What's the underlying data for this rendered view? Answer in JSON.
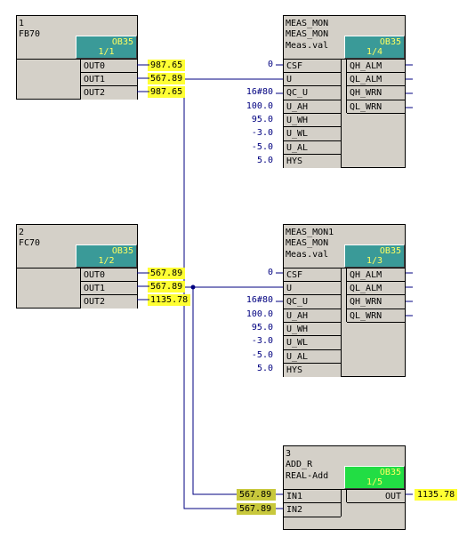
{
  "blocks": {
    "fb70": {
      "num": "1",
      "name": "FB70",
      "ob": "OB35",
      "seq": "1/1",
      "outputs": [
        {
          "pin": "OUT0",
          "val": "987.65"
        },
        {
          "pin": "OUT1",
          "val": "567.89"
        },
        {
          "pin": "OUT2",
          "val": "987.65"
        }
      ]
    },
    "fc70": {
      "num": "2",
      "name": "FC70",
      "ob": "OB35",
      "seq": "1/2",
      "outputs": [
        {
          "pin": "OUT0",
          "val": "567.89"
        },
        {
          "pin": "OUT1",
          "val": "567.89"
        },
        {
          "pin": "OUT2",
          "val": "1135.78"
        }
      ]
    },
    "meas1": {
      "line1": "MEAS_MON",
      "line2": "MEAS_MON",
      "line3": "Meas.val",
      "ob": "OB35",
      "seq": "1/4",
      "inputs": [
        {
          "pin": "CSF",
          "val": "0"
        },
        {
          "pin": "U",
          "val": ""
        },
        {
          "pin": "QC_U",
          "val": "16#80"
        },
        {
          "pin": "U_AH",
          "val": "100.0"
        },
        {
          "pin": "U_WH",
          "val": "95.0"
        },
        {
          "pin": "U_WL",
          "val": "-3.0"
        },
        {
          "pin": "U_AL",
          "val": "-5.0"
        },
        {
          "pin": "HYS",
          "val": "5.0"
        }
      ],
      "outputs": [
        "QH_ALM",
        "QL_ALM",
        "QH_WRN",
        "QL_WRN"
      ]
    },
    "meas2": {
      "line1": "MEAS_MON1",
      "line2": "MEAS_MON",
      "line3": "Meas.val",
      "ob": "OB35",
      "seq": "1/3",
      "inputs": [
        {
          "pin": "CSF",
          "val": "0"
        },
        {
          "pin": "U",
          "val": ""
        },
        {
          "pin": "QC_U",
          "val": "16#80"
        },
        {
          "pin": "U_AH",
          "val": "100.0"
        },
        {
          "pin": "U_WH",
          "val": "95.0"
        },
        {
          "pin": "U_WL",
          "val": "-3.0"
        },
        {
          "pin": "U_AL",
          "val": "-5.0"
        },
        {
          "pin": "HYS",
          "val": "5.0"
        }
      ],
      "outputs": [
        "QH_ALM",
        "QL_ALM",
        "QH_WRN",
        "QL_WRN"
      ]
    },
    "add": {
      "num": "3",
      "line2": "ADD_R",
      "line3": "REAL-Add",
      "ob": "OB35",
      "seq": "1/5",
      "inputs": [
        {
          "pin": "IN1",
          "val": "567.89"
        },
        {
          "pin": "IN2",
          "val": "567.89"
        }
      ],
      "output": {
        "pin": "OUT",
        "val": "1135.78"
      }
    }
  },
  "colors": {
    "tag_teal": "#3a9a98",
    "tag_green": "#22dd44",
    "value_yellow": "#ffff33",
    "value_olive": "#c8c83c",
    "wire": "#000080",
    "block_bg": "#d4d0c8"
  }
}
